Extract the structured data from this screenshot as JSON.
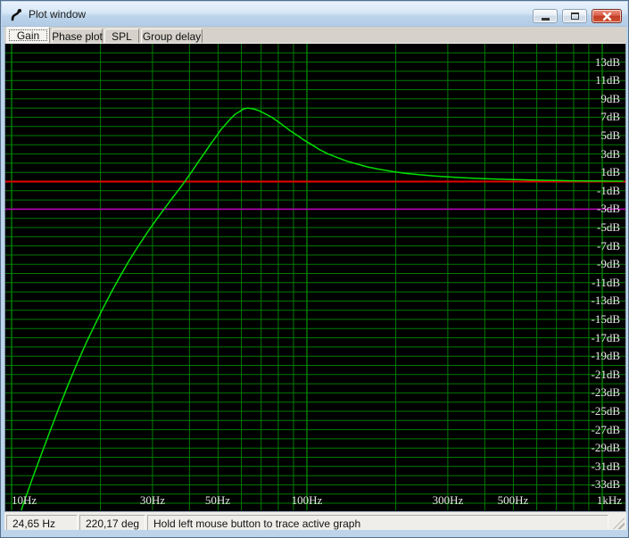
{
  "window": {
    "title": "Plot window",
    "controls": {
      "minimize": "minimize",
      "maximize": "maximize",
      "close": "close"
    }
  },
  "tabs": [
    {
      "label": "Gain",
      "active": true
    },
    {
      "label": "Phase plot",
      "active": false
    },
    {
      "label": "SPL",
      "active": false
    },
    {
      "label": "Group delay",
      "active": false
    }
  ],
  "status_bar": {
    "frequency": "24,65 Hz",
    "phase": "220,17 deg",
    "hint": "Hold left mouse button to trace active graph"
  },
  "colors": {
    "plot_bg": "#000000",
    "grid": "#007c00",
    "grid_major": "#00b400",
    "curve": "#00dd00",
    "ref_zero": "#e60000",
    "ref_minus3": "#b800b8",
    "titlebar": "#bdd4ea"
  },
  "chart_data": {
    "type": "line",
    "x_scale": "log",
    "x_range_hz": [
      10,
      1200
    ],
    "y_range_db": [
      -36,
      15
    ],
    "x_ticks": [
      {
        "value": 10,
        "label": "10Hz"
      },
      {
        "value": 30,
        "label": "30Hz"
      },
      {
        "value": 50,
        "label": "50Hz"
      },
      {
        "value": 100,
        "label": "100Hz"
      },
      {
        "value": 300,
        "label": "300Hz"
      },
      {
        "value": 500,
        "label": "500Hz"
      },
      {
        "value": 1000,
        "label": "1kHz"
      }
    ],
    "y_ticks": [
      {
        "value": 13,
        "label": "13dB"
      },
      {
        "value": 11,
        "label": "11dB"
      },
      {
        "value": 9,
        "label": "9dB"
      },
      {
        "value": 7,
        "label": "7dB"
      },
      {
        "value": 5,
        "label": "5dB"
      },
      {
        "value": 3,
        "label": "3dB"
      },
      {
        "value": 1,
        "label": "1dB"
      },
      {
        "value": -1,
        "label": "-1dB"
      },
      {
        "value": -3,
        "label": "-3dB"
      },
      {
        "value": -5,
        "label": "-5dB"
      },
      {
        "value": -7,
        "label": "-7dB"
      },
      {
        "value": -9,
        "label": "-9dB"
      },
      {
        "value": -11,
        "label": "-11dB"
      },
      {
        "value": -13,
        "label": "-13dB"
      },
      {
        "value": -15,
        "label": "-15dB"
      },
      {
        "value": -17,
        "label": "-17dB"
      },
      {
        "value": -19,
        "label": "-19dB"
      },
      {
        "value": -21,
        "label": "-21dB"
      },
      {
        "value": -23,
        "label": "-23dB"
      },
      {
        "value": -25,
        "label": "-25dB"
      },
      {
        "value": -27,
        "label": "-27dB"
      },
      {
        "value": -29,
        "label": "-29dB"
      },
      {
        "value": -31,
        "label": "-31dB"
      },
      {
        "value": -33,
        "label": "-33dB"
      }
    ],
    "x_grid_hz": [
      10,
      20,
      30,
      40,
      50,
      60,
      70,
      80,
      90,
      100,
      200,
      300,
      400,
      500,
      600,
      700,
      800,
      900,
      1000
    ],
    "y_grid": {
      "max_db": 14,
      "min_db": -35,
      "step_db": 1
    },
    "reference_lines": [
      {
        "name": "zero-db-reference-line",
        "db": 0,
        "color": "#e60000",
        "width": 2
      },
      {
        "name": "minus-3db-reference-line",
        "db": -3,
        "color": "#b800b8",
        "width": 1.6
      }
    ],
    "series": [
      {
        "name": "gain-response",
        "color": "#00dd00",
        "width": 1.5,
        "points": [
          [
            10.5,
            -37.0
          ],
          [
            10.9,
            -35.3
          ],
          [
            11.7,
            -32.5
          ],
          [
            12.5,
            -30.0
          ],
          [
            13.4,
            -27.4
          ],
          [
            14.4,
            -24.8
          ],
          [
            15.5,
            -22.2
          ],
          [
            16.6,
            -19.9
          ],
          [
            17.8,
            -17.7
          ],
          [
            19.0,
            -15.8
          ],
          [
            20.3,
            -13.9
          ],
          [
            21.8,
            -12.0
          ],
          [
            23.4,
            -10.2
          ],
          [
            25.0,
            -8.6
          ],
          [
            27.0,
            -6.9
          ],
          [
            29.0,
            -5.4
          ],
          [
            31.0,
            -4.1
          ],
          [
            33.0,
            -2.9
          ],
          [
            35.0,
            -1.8
          ],
          [
            37.0,
            -0.8
          ],
          [
            39.0,
            0.2
          ],
          [
            41.0,
            1.2
          ],
          [
            43.0,
            2.2
          ],
          [
            45.0,
            3.1
          ],
          [
            47.0,
            4.0
          ],
          [
            49.0,
            4.8
          ],
          [
            51.0,
            5.6
          ],
          [
            53.0,
            6.2
          ],
          [
            55.0,
            6.8
          ],
          [
            57.0,
            7.3
          ],
          [
            59.0,
            7.6
          ],
          [
            61.0,
            7.9
          ],
          [
            63.0,
            8.0
          ],
          [
            66.0,
            7.9
          ],
          [
            69.0,
            7.7
          ],
          [
            72.0,
            7.4
          ],
          [
            76.0,
            7.0
          ],
          [
            80.0,
            6.5
          ],
          [
            84.0,
            6.0
          ],
          [
            88.0,
            5.5
          ],
          [
            93.0,
            5.0
          ],
          [
            98.0,
            4.5
          ],
          [
            104.0,
            4.0
          ],
          [
            110.0,
            3.5
          ],
          [
            118.0,
            3.0
          ],
          [
            127.0,
            2.6
          ],
          [
            137.0,
            2.2
          ],
          [
            148.0,
            1.9
          ],
          [
            160.0,
            1.6
          ],
          [
            175.0,
            1.35
          ],
          [
            195.0,
            1.1
          ],
          [
            215.0,
            0.9
          ],
          [
            240.0,
            0.75
          ],
          [
            270.0,
            0.6
          ],
          [
            300.0,
            0.5
          ],
          [
            340.0,
            0.42
          ],
          [
            380.0,
            0.34
          ],
          [
            430.0,
            0.28
          ],
          [
            480.0,
            0.23
          ],
          [
            540.0,
            0.19
          ],
          [
            610.0,
            0.15
          ],
          [
            690.0,
            0.12
          ],
          [
            780.0,
            0.09
          ],
          [
            880.0,
            0.07
          ],
          [
            1000.0,
            0.06
          ],
          [
            1180.0,
            0.04
          ]
        ]
      }
    ]
  }
}
